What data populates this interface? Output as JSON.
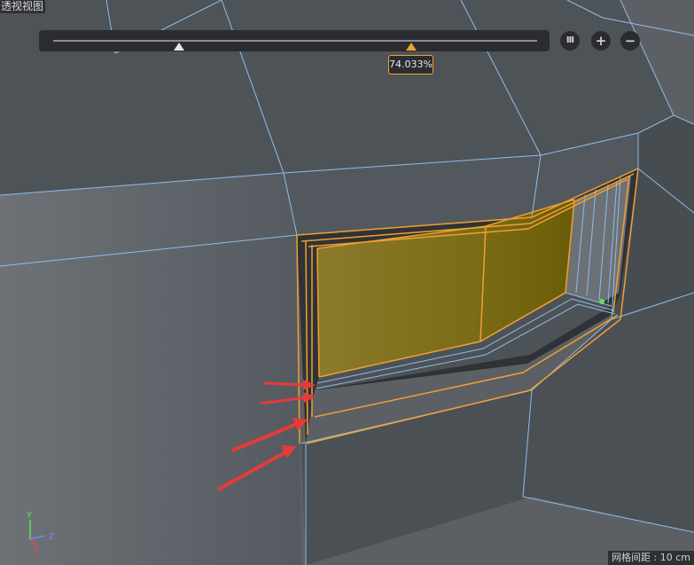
{
  "viewport": {
    "label": "透视视图",
    "grid_spacing": "网格间距 : 10 cm"
  },
  "slider": {
    "value_display": "74.033%",
    "white_handle_fraction": 0.25,
    "orange_handle_fraction": 0.74
  },
  "buttons": {
    "pause_glyph": "III",
    "plus_glyph": "+",
    "minus_glyph": "−"
  },
  "axes": {
    "y": "Y",
    "z": "Z",
    "x": "X"
  },
  "colors": {
    "mesh_face": "#4c5156",
    "edge": "#8fbde8",
    "selected_edge": "#f0a030",
    "inner_face": "#7d6d1c",
    "arrow": "#e83a3a",
    "ui_panel": "#2b2c2f"
  }
}
